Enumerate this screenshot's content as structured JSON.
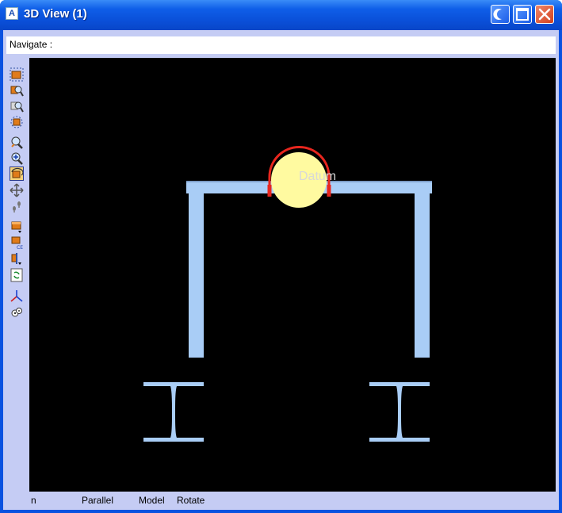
{
  "window": {
    "title": "3D View (1)",
    "app_icon": "A"
  },
  "navigate": {
    "label": "Navigate :"
  },
  "toolbar": {
    "icons": [
      "zoom-extents-icon",
      "zoom-window-icon",
      "zoom-previous-icon",
      "zoom-selection-icon",
      "zoom-dynamic-icon",
      "zoom-in-icon",
      "orbit-icon",
      "pan-icon",
      "walk-icon",
      "view-presets-icon",
      "camera-eye-icon",
      "clipping-icon",
      "refresh-icon",
      "axes-icon",
      "settings-icon"
    ],
    "active": "orbit-icon"
  },
  "viewport": {
    "label": "Datum",
    "colors": {
      "steel": "#a9cdf6",
      "pipe": "#fffaa0",
      "clamp": "#e8261e",
      "background": "#000000"
    }
  },
  "status": {
    "items": [
      "n",
      "Parallel",
      "Model",
      "Rotate"
    ]
  }
}
